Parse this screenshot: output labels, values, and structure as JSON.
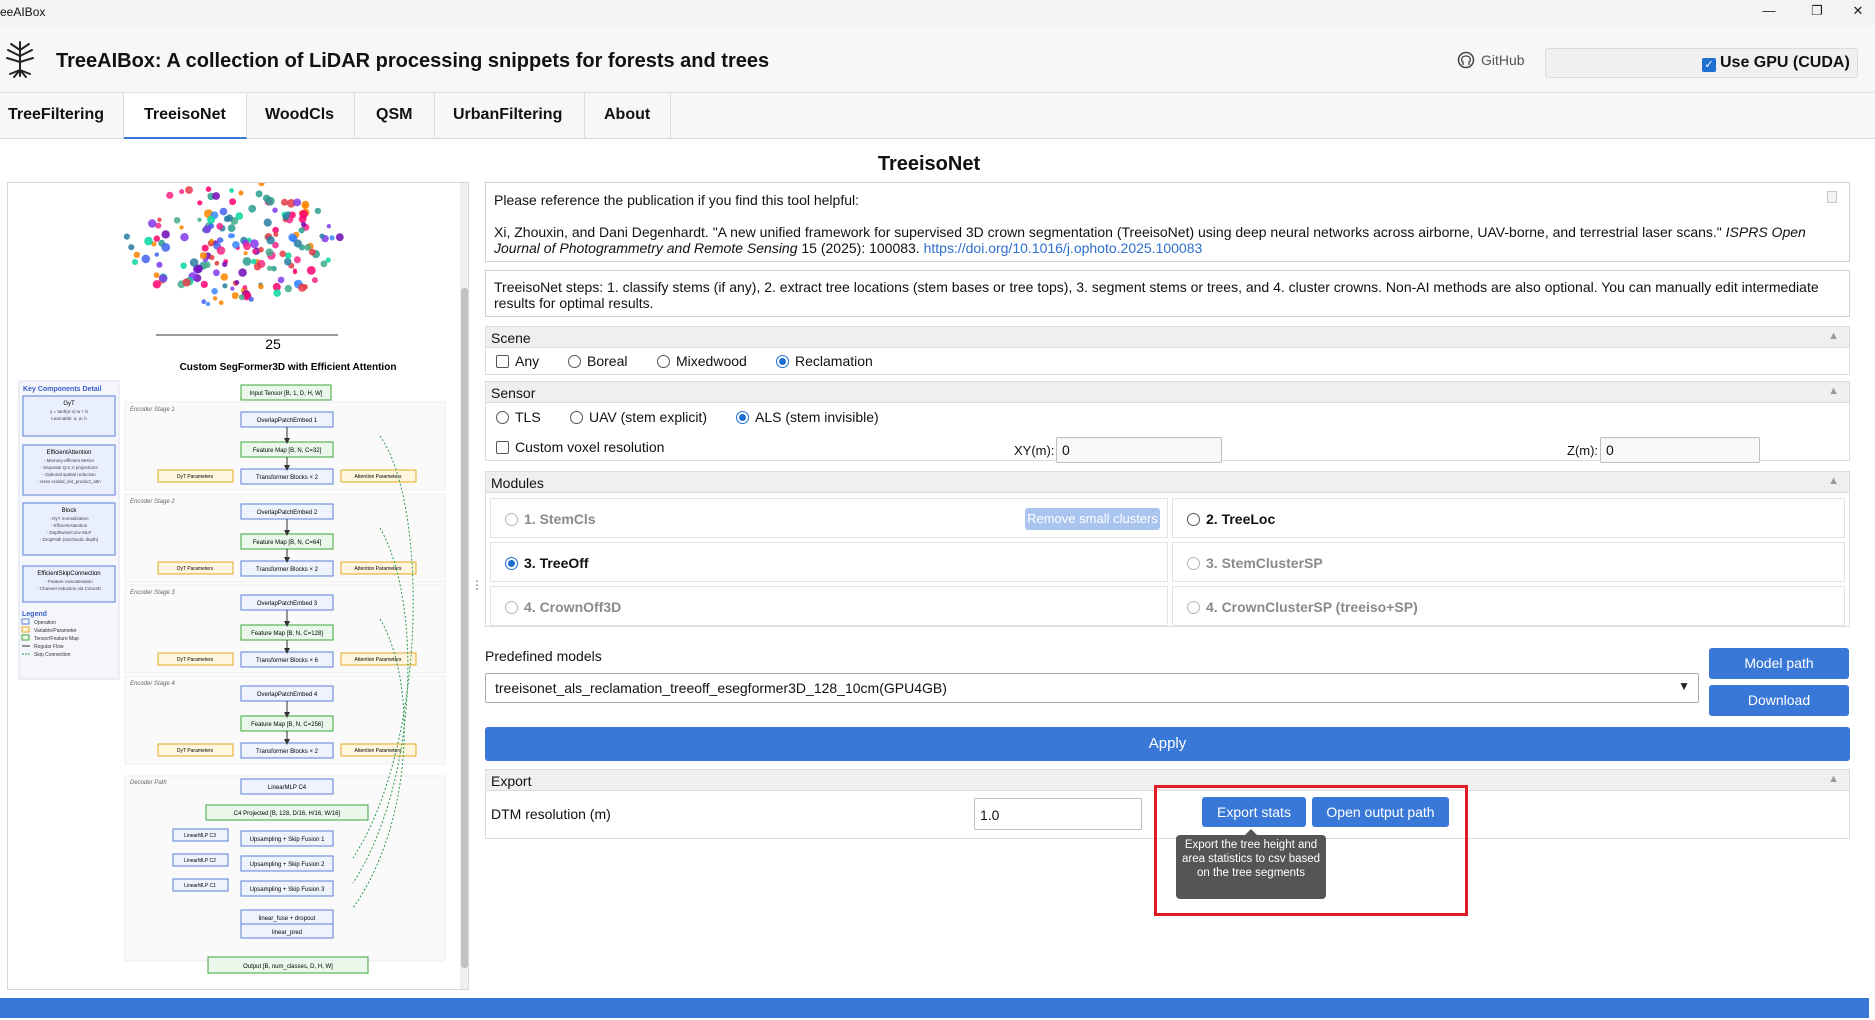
{
  "window": {
    "title": "eeAIBox",
    "minimize": "—",
    "restore": "❐",
    "close": "✕"
  },
  "header": {
    "app_title": "TreeAIBox: A collection of LiDAR processing snippets for forests and trees",
    "github_label": "GitHub",
    "gpu_label": "Use GPU (CUDA)",
    "gpu_checked": true
  },
  "tabs": [
    {
      "label": "TreeFiltering",
      "active": false
    },
    {
      "label": "TreeisoNet",
      "active": true
    },
    {
      "label": "WoodCls",
      "active": false
    },
    {
      "label": "QSM",
      "active": false
    },
    {
      "label": "UrbanFiltering",
      "active": false
    },
    {
      "label": "About",
      "active": false
    }
  ],
  "page_title": "TreeisoNet",
  "diagram": {
    "scale_label": "25",
    "title": "Custom SegFormer3D with Efficient Attention",
    "key_title": "Key Components Detail",
    "key_items": [
      {
        "name": "GyT",
        "desc": "y = tanh(α·x)·w + b\nLearnable: α, w, b"
      },
      {
        "name": "EfficientAttention",
        "desc": "- Memory-efficient MHSA\n- Separate Q,K,V projections\n- Optional spatial reduction\n- Uses scaled_dot_product_attn"
      },
      {
        "name": "Block",
        "desc": "- DyT normalization\n- EfficientAttention\n- DepthwiseConv MLP\n- DropPath (stochastic depth)"
      },
      {
        "name": "EfficientSkipConnection",
        "desc": "- Feature concatenation\n- Channel reduction via Conv3D"
      }
    ],
    "legend_title": "Legend",
    "legend_items": [
      "Operation",
      "Variable/Parameter",
      "Tensor/Feature Map",
      "Regular Flow",
      "Skip Connection"
    ],
    "input_label": "Input Tensor [B, 1, D, H, W]",
    "stages": [
      {
        "name": "Encoder Stage 1",
        "embed": "OverlapPatchEmbed 1",
        "feature": "Feature Map [B, N, C=32]",
        "blocks": "Transformer Blocks × 2"
      },
      {
        "name": "Encoder Stage 2",
        "embed": "OverlapPatchEmbed 2",
        "feature": "Feature Map [B, N, C=64]",
        "blocks": "Transformer Blocks × 2"
      },
      {
        "name": "Encoder Stage 3",
        "embed": "OverlapPatchEmbed 3",
        "feature": "Feature Map [B, N, C=128]",
        "blocks": "Transformer Blocks × 6"
      },
      {
        "name": "Encoder Stage 4",
        "embed": "OverlapPatchEmbed 4",
        "feature": "Feature Map [B, N, C=256]",
        "blocks": "Transformer Blocks × 2"
      }
    ],
    "dyt_label": "DyT Parameters",
    "attn_label": "Attention Parameters",
    "decoder_title": "Decoder Path",
    "linear_c4": "LinearMLP C4",
    "c4_projected": "C4 Projected [B, 128, D/16, H/16, W/16]",
    "linear_c3": "LinearMLP C3",
    "linear_c2": "LinearMLP C2",
    "linear_c1": "LinearMLP C1",
    "fusions": [
      "Upsampling + Skip Fusion 1",
      "Upsampling + Skip Fusion 2",
      "Upsampling + Skip Fusion 3"
    ],
    "fuse_dropout": "linear_fuse + dropout",
    "linear_pred": "linear_pred",
    "output_label": "Output [B, num_classes, D, H, W]"
  },
  "reference": {
    "intro": "Please reference the publication if you find this tool helpful:",
    "citation_main": "Xi, Zhouxin, and Dani Degenhardt. \"A new unified framework for supervised 3D crown segmentation (TreeisoNet) using deep neural networks across airborne, UAV-borne, and terrestrial laser scans.\" ",
    "journal": "ISPRS Open Journal of Photogrammetry and Remote Sensing",
    "citation_tail": " 15 (2025): 100083. ",
    "doi": "https://doi.org/10.1016/j.ophoto.2025.100083"
  },
  "steps_text": "TreeisoNet steps: 1. classify stems (if any), 2. extract tree locations (stem bases or tree tops), 3. segment stems or trees, and 4. cluster crowns. Non-AI methods are also optional. You can manually edit intermediate results for optimal results.",
  "scene": {
    "title": "Scene",
    "any_label": "Any",
    "options": [
      {
        "label": "Boreal",
        "selected": false
      },
      {
        "label": "Mixedwood",
        "selected": false
      },
      {
        "label": "Reclamation",
        "selected": true
      }
    ]
  },
  "sensor": {
    "title": "Sensor",
    "options": [
      {
        "label": "TLS",
        "selected": false
      },
      {
        "label": "UAV (stem explicit)",
        "selected": false
      },
      {
        "label": "ALS (stem invisible)",
        "selected": true
      }
    ],
    "custom_voxel_label": "Custom voxel resolution",
    "xy_label": "XY(m):",
    "xy_value": "0",
    "z_label": "Z(m):",
    "z_value": "0"
  },
  "modules": {
    "title": "Modules",
    "items": [
      {
        "label": "1. StemCls",
        "selected": false,
        "enabled": false
      },
      {
        "label": "2. TreeLoc",
        "selected": false,
        "enabled": true
      },
      {
        "label": "3. TreeOff",
        "selected": true,
        "enabled": true
      },
      {
        "label": "3. StemClusterSP",
        "selected": false,
        "enabled": false
      },
      {
        "label": "4. CrownOff3D",
        "selected": false,
        "enabled": false
      },
      {
        "label": "4. CrownClusterSP (treeiso+SP)",
        "selected": false,
        "enabled": false
      }
    ],
    "remove_small_clusters": "Remove small clusters"
  },
  "predefined": {
    "label": "Predefined models",
    "selected": "treeisonet_als_reclamation_treeoff_esegformer3D_128_10cm(GPU4GB)",
    "model_path": "Model path",
    "download": "Download"
  },
  "apply_label": "Apply",
  "export": {
    "title": "Export",
    "dtm_label": "DTM resolution (m)",
    "dtm_value": "1.0",
    "export_stats": "Export stats",
    "open_output": "Open output path",
    "tooltip": "Export the tree height and area statistics to csv based on the tree segments"
  },
  "colors": {
    "accent": "#3a78d8",
    "highlight": "#e21b23"
  }
}
